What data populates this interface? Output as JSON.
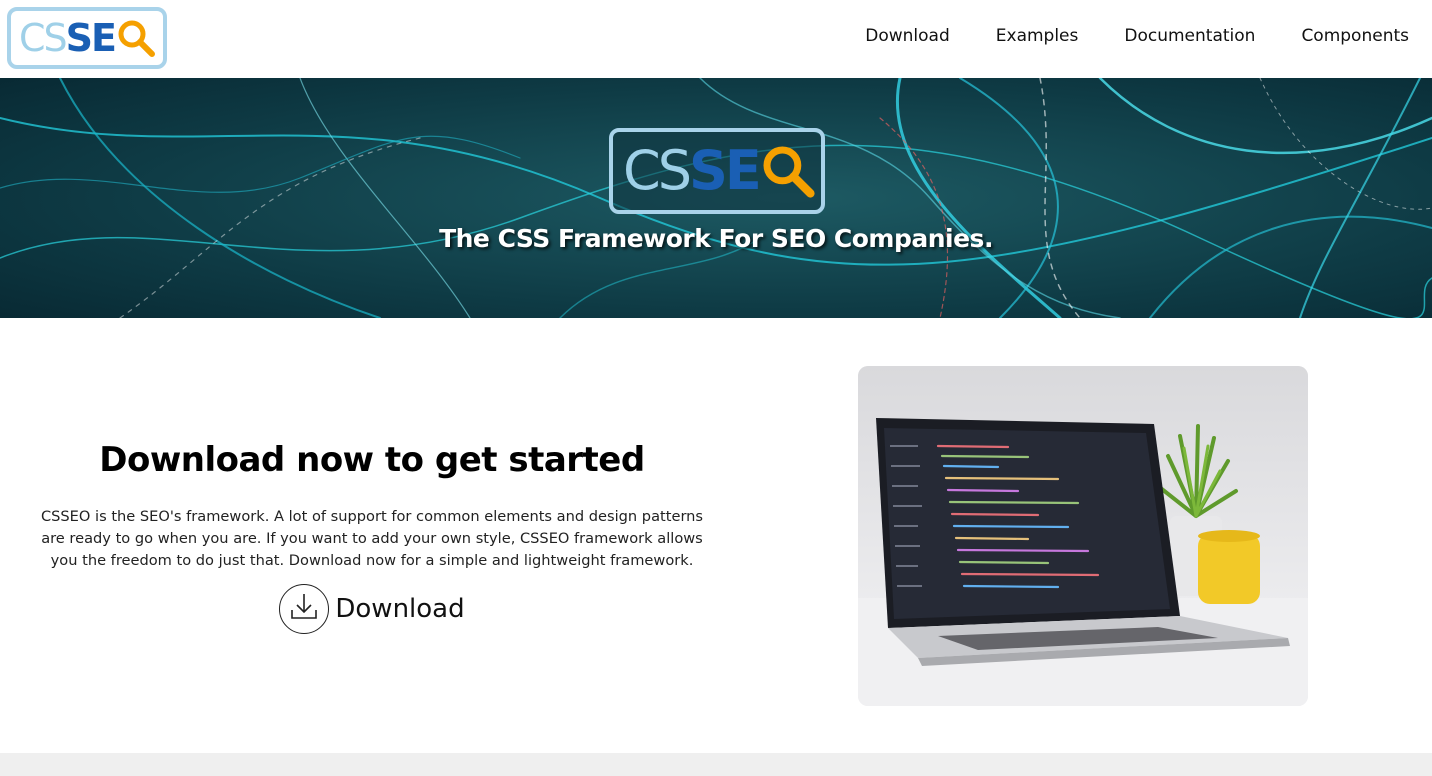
{
  "header": {
    "logo": {
      "part1": "CS",
      "part2": "SE",
      "part3": "Q"
    },
    "nav": [
      "Download",
      "Examples",
      "Documentation",
      "Components"
    ]
  },
  "hero": {
    "tagline": "The CSS Framework For SEO Companies."
  },
  "main": {
    "title": "Download now to get started",
    "body": "CSSEO is the SEO's framework. A lot of support for common elements and design patterns are ready to go when you are. If you want to add your own style, CSSEO framework allows you the freedom to do just that. Download now for a simple and lightweight framework.",
    "download_label": "Download"
  },
  "colors": {
    "logo_light": "#9fd0e8",
    "logo_blue": "#1a5fb4",
    "logo_orange": "#f5a000",
    "hero_bg": "#0d3c47",
    "footer_bg": "#efefef"
  },
  "icons": {
    "download": "download-icon",
    "magnifier": "magnifier-icon"
  }
}
